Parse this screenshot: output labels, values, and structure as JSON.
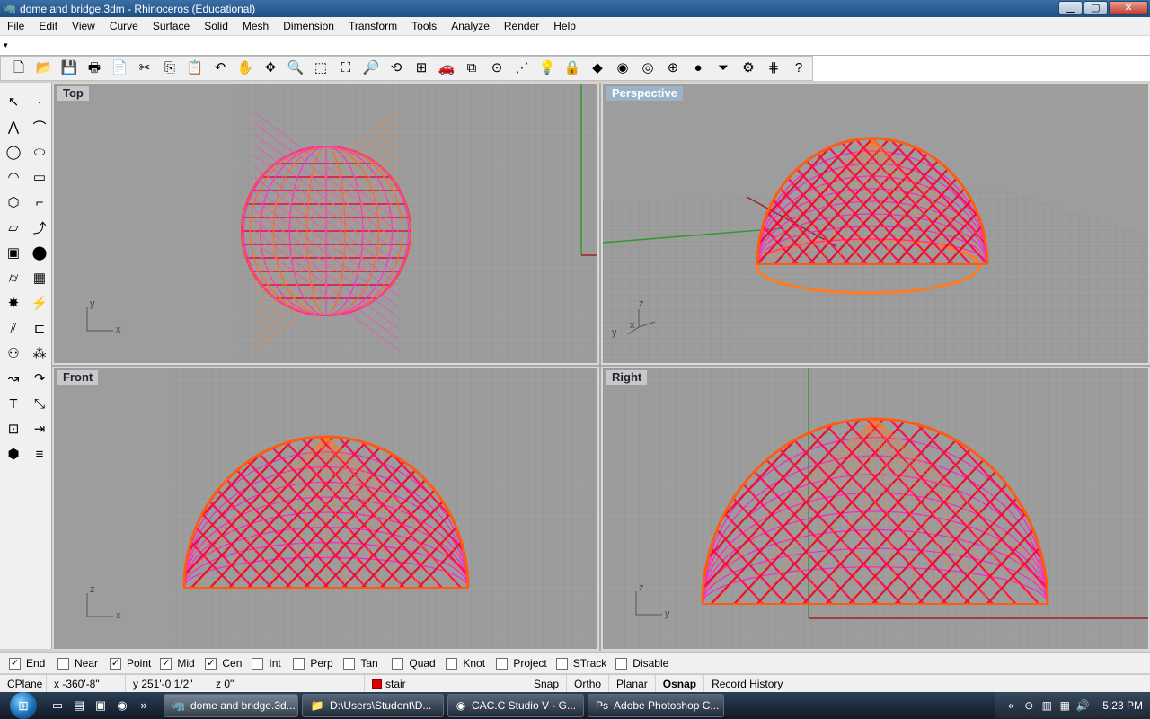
{
  "window": {
    "title": "dome and bridge.3dm - Rhinoceros (Educational)",
    "min_icon": "▁",
    "max_icon": "▢",
    "close_icon": "✕"
  },
  "menubar": {
    "items": [
      "File",
      "Edit",
      "View",
      "Curve",
      "Surface",
      "Solid",
      "Mesh",
      "Dimension",
      "Transform",
      "Tools",
      "Analyze",
      "Render",
      "Help"
    ]
  },
  "toolbar": {
    "icons": [
      {
        "name": "new-icon",
        "glyph": "🗋"
      },
      {
        "name": "open-icon",
        "glyph": "📂"
      },
      {
        "name": "save-icon",
        "glyph": "💾"
      },
      {
        "name": "print-icon",
        "glyph": "🖶"
      },
      {
        "name": "import-icon",
        "glyph": "📄"
      },
      {
        "name": "cut-icon",
        "glyph": "✂"
      },
      {
        "name": "copy-icon",
        "glyph": "⎘"
      },
      {
        "name": "paste-icon",
        "glyph": "📋"
      },
      {
        "name": "undo-icon",
        "glyph": "↶"
      },
      {
        "name": "pan-icon",
        "glyph": "✋"
      },
      {
        "name": "rotate-view-icon",
        "glyph": "✥"
      },
      {
        "name": "zoom-icon",
        "glyph": "🔍"
      },
      {
        "name": "zoom-window-icon",
        "glyph": "⬚"
      },
      {
        "name": "zoom-extents-icon",
        "glyph": "⛶"
      },
      {
        "name": "zoom-selected-icon",
        "glyph": "🔎"
      },
      {
        "name": "undo-view-icon",
        "glyph": "⟲"
      },
      {
        "name": "four-viewports-icon",
        "glyph": "⊞"
      },
      {
        "name": "car-icon",
        "glyph": "🚗"
      },
      {
        "name": "named-views-icon",
        "glyph": "⧉"
      },
      {
        "name": "cplane-icon",
        "glyph": "⊙"
      },
      {
        "name": "select-points-icon",
        "glyph": "⋰"
      },
      {
        "name": "light-icon",
        "glyph": "💡"
      },
      {
        "name": "lock-icon",
        "glyph": "🔒"
      },
      {
        "name": "layer-icon",
        "glyph": "◆"
      },
      {
        "name": "color-wheel-icon",
        "glyph": "◉"
      },
      {
        "name": "wireframe-icon",
        "glyph": "◎"
      },
      {
        "name": "ghosted-icon",
        "glyph": "⊕"
      },
      {
        "name": "render-sphere-icon",
        "glyph": "●"
      },
      {
        "name": "filter-icon",
        "glyph": "⏷"
      },
      {
        "name": "options-icon",
        "glyph": "⚙"
      },
      {
        "name": "grid-snap-icon",
        "glyph": "⋕"
      },
      {
        "name": "help-icon",
        "glyph": "?"
      }
    ]
  },
  "left_toolbar": {
    "icons": [
      {
        "name": "select-arrow-icon",
        "glyph": "↖"
      },
      {
        "name": "point-icon",
        "glyph": "·"
      },
      {
        "name": "polyline-icon",
        "glyph": "⋀"
      },
      {
        "name": "curve-icon",
        "glyph": "⌒"
      },
      {
        "name": "circle-icon",
        "glyph": "◯"
      },
      {
        "name": "ellipse-icon",
        "glyph": "⬭"
      },
      {
        "name": "arc-icon",
        "glyph": "◠"
      },
      {
        "name": "rectangle-icon",
        "glyph": "▭"
      },
      {
        "name": "polygon-icon",
        "glyph": "⬡"
      },
      {
        "name": "fillet-icon",
        "glyph": "⌐"
      },
      {
        "name": "surface-icon",
        "glyph": "▱"
      },
      {
        "name": "extrude-icon",
        "glyph": "⤴"
      },
      {
        "name": "box-icon",
        "glyph": "▣"
      },
      {
        "name": "boolean-icon",
        "glyph": "⬤"
      },
      {
        "name": "cylinder-icon",
        "glyph": "⌭"
      },
      {
        "name": "mesh-icon",
        "glyph": "▦"
      },
      {
        "name": "explode-icon",
        "glyph": "✸"
      },
      {
        "name": "trim-icon",
        "glyph": "⚡"
      },
      {
        "name": "split-icon",
        "glyph": "⫽"
      },
      {
        "name": "join-icon",
        "glyph": "⊏"
      },
      {
        "name": "group-icon",
        "glyph": "⚇"
      },
      {
        "name": "array-icon",
        "glyph": "⁂"
      },
      {
        "name": "blend-icon",
        "glyph": "↝"
      },
      {
        "name": "offset-icon",
        "glyph": "↷"
      },
      {
        "name": "text-icon",
        "glyph": "T"
      },
      {
        "name": "scale-icon",
        "glyph": "⤡"
      },
      {
        "name": "snap-grid-icon",
        "glyph": "⊡"
      },
      {
        "name": "dimension-icon",
        "glyph": "⇥"
      },
      {
        "name": "solid-tools-icon",
        "glyph": "⬢"
      },
      {
        "name": "contour-icon",
        "glyph": "≡"
      }
    ]
  },
  "viewports": [
    {
      "id": "top",
      "title": "Top",
      "axis1": "y",
      "axis2": "x",
      "active": false
    },
    {
      "id": "perspective",
      "title": "Perspective",
      "axis1": "z",
      "axis2": "x",
      "axis3": "y",
      "active": true
    },
    {
      "id": "front",
      "title": "Front",
      "axis1": "z",
      "axis2": "x",
      "active": false
    },
    {
      "id": "right",
      "title": "Right",
      "axis1": "z",
      "axis2": "y",
      "active": false
    }
  ],
  "osnap": {
    "items": [
      {
        "label": "End",
        "checked": true
      },
      {
        "label": "Near",
        "checked": false
      },
      {
        "label": "Point",
        "checked": true
      },
      {
        "label": "Mid",
        "checked": true
      },
      {
        "label": "Cen",
        "checked": true
      },
      {
        "label": "Int",
        "checked": false
      },
      {
        "label": "Perp",
        "checked": false
      },
      {
        "label": "Tan",
        "checked": false
      },
      {
        "label": "Quad",
        "checked": false
      },
      {
        "label": "Knot",
        "checked": false
      },
      {
        "label": "Project",
        "checked": false
      },
      {
        "label": "STrack",
        "checked": false
      },
      {
        "label": "Disable",
        "checked": false
      }
    ]
  },
  "status": {
    "cplane": "CPlane",
    "x": "x -360'-8\"",
    "y": "y 251'-0 1/2\"",
    "z": "z 0\"",
    "layer": "stair",
    "layer_color": "#e00000",
    "snap": "Snap",
    "ortho": "Ortho",
    "planar": "Planar",
    "osnap": "Osnap",
    "record_history": "Record History"
  },
  "taskbar": {
    "start_icon": "⊞",
    "quicklaunch": [
      {
        "name": "show-desktop-icon",
        "glyph": "▭"
      },
      {
        "name": "explorer-quick-icon",
        "glyph": "▤"
      },
      {
        "name": "media-icon",
        "glyph": "▣"
      },
      {
        "name": "chrome-quick-icon",
        "glyph": "◉"
      },
      {
        "name": "more-icon",
        "glyph": "»"
      }
    ],
    "tasks": [
      {
        "name": "task-rhino",
        "icon": "🦏",
        "label": "dome and bridge.3d...",
        "active": true
      },
      {
        "name": "task-explorer",
        "icon": "📁",
        "label": "D:\\Users\\Student\\D...",
        "active": false
      },
      {
        "name": "task-chrome",
        "icon": "◉",
        "label": "CAC.C Studio V - G...",
        "active": false
      },
      {
        "name": "task-photoshop",
        "icon": "Ps",
        "label": "Adobe Photoshop C...",
        "active": false
      }
    ],
    "tray_icons": [
      "«",
      "⊙",
      "▥",
      "▦",
      "🔊"
    ],
    "clock": "5:23 PM"
  }
}
